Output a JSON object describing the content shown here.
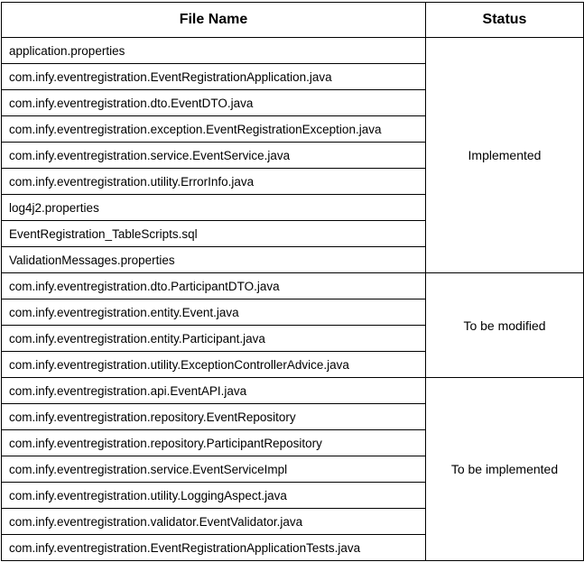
{
  "table": {
    "headers": {
      "file_name": "File Name",
      "status": "Status"
    },
    "groups": [
      {
        "status": "Implemented",
        "files": [
          "application.properties",
          "com.infy.eventregistration.EventRegistrationApplication.java",
          "com.infy.eventregistration.dto.EventDTO.java",
          "com.infy.eventregistration.exception.EventRegistrationException.java",
          "com.infy.eventregistration.service.EventService.java",
          "com.infy.eventregistration.utility.ErrorInfo.java",
          "log4j2.properties",
          "EventRegistration_TableScripts.sql",
          "ValidationMessages.properties"
        ]
      },
      {
        "status": "To be modified",
        "files": [
          "com.infy.eventregistration.dto.ParticipantDTO.java",
          "com.infy.eventregistration.entity.Event.java",
          "com.infy.eventregistration.entity.Participant.java",
          "com.infy.eventregistration.utility.ExceptionControllerAdvice.java"
        ]
      },
      {
        "status": "To be implemented",
        "files": [
          "com.infy.eventregistration.api.EventAPI.java",
          "com.infy.eventregistration.repository.EventRepository",
          "com.infy.eventregistration.repository.ParticipantRepository",
          "com.infy.eventregistration.service.EventServiceImpl",
          "com.infy.eventregistration.utility.LoggingAspect.java",
          "com.infy.eventregistration.validator.EventValidator.java",
          "com.infy.eventregistration.EventRegistrationApplicationTests.java"
        ]
      }
    ]
  }
}
